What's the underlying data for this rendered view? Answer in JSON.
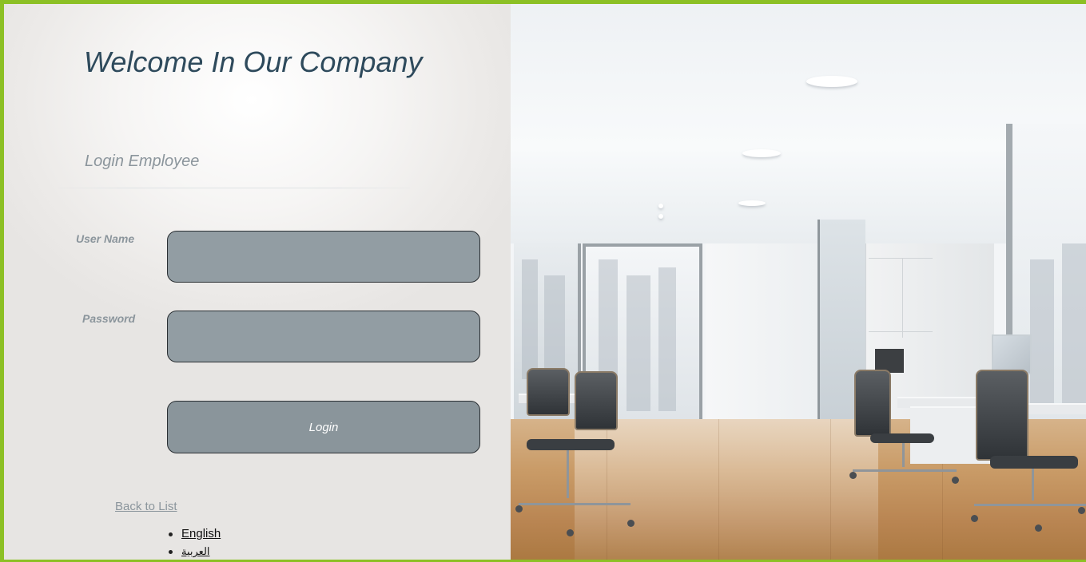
{
  "header": {
    "title": "Welcome In Our Company"
  },
  "form": {
    "subtitle": "Login Employee",
    "username_label": "User Name",
    "username_value": "",
    "password_label": "Password",
    "password_value": "",
    "login_label": "Login"
  },
  "footer": {
    "back_link": "Back to List",
    "languages": [
      "English",
      "العربية"
    ]
  },
  "colors": {
    "accent_border": "#8cc025",
    "title": "#2e4a5c",
    "field_bg": "#929da3",
    "button_bg": "#8a959b"
  },
  "icons": {
    "bullet": "bullet-icon"
  }
}
